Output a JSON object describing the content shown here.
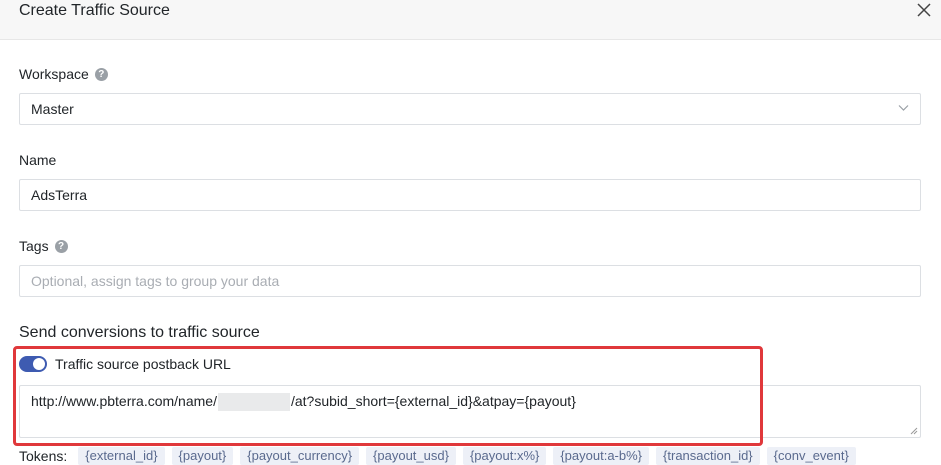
{
  "dialog": {
    "title": "Create Traffic Source"
  },
  "workspace": {
    "label": "Workspace",
    "value": "Master"
  },
  "name": {
    "label": "Name",
    "value": "AdsTerra"
  },
  "tags": {
    "label": "Tags",
    "placeholder": "Optional, assign tags to group your data"
  },
  "conversions": {
    "section_title": "Send conversions to traffic source",
    "toggle_label": "Traffic source postback URL",
    "toggle_on": true,
    "url_prefix": "http://www.pbterra.com/name/",
    "url_suffix": "/at?subid_short={external_id}&atpay={payout}"
  },
  "tokens": {
    "label": "Tokens:",
    "items": [
      "{external_id}",
      "{payout}",
      "{payout_currency}",
      "{payout_usd}",
      "{payout:x%}",
      "{payout:a-b%}",
      "{transaction_id}",
      "{conv_event}"
    ]
  },
  "colors": {
    "accent": "#3e5bb1",
    "highlight": "#e0383b"
  }
}
